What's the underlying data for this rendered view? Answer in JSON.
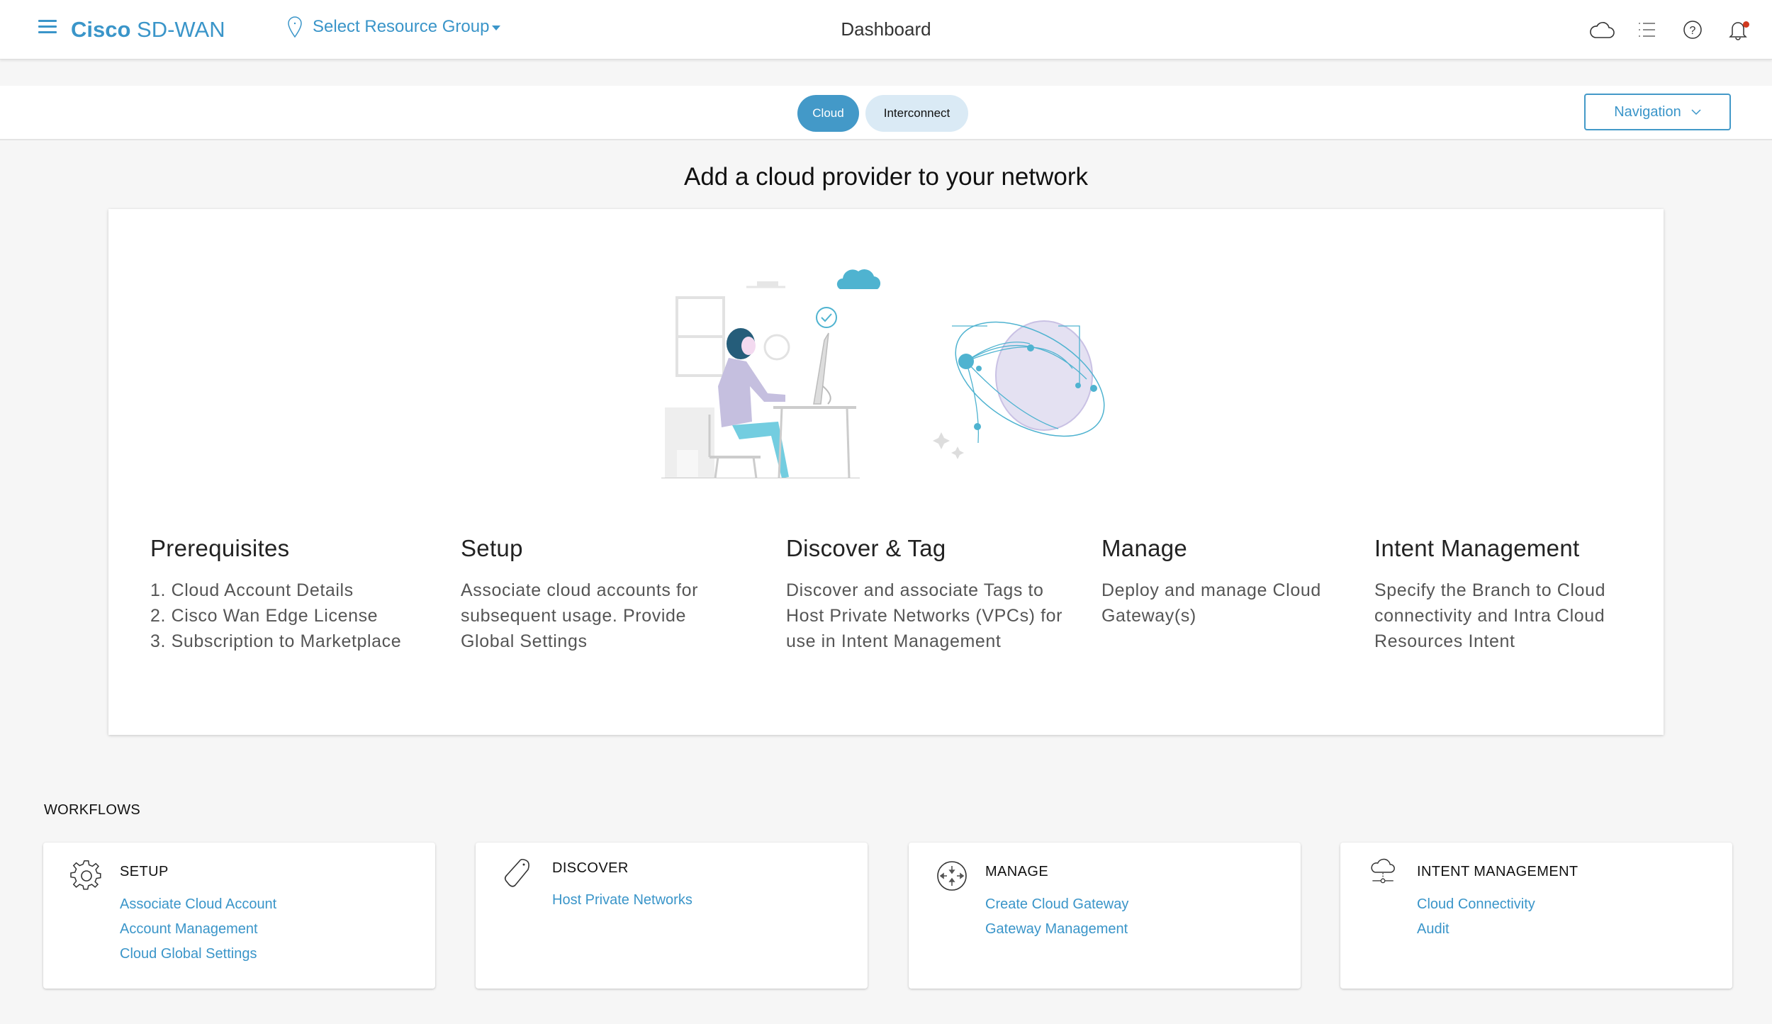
{
  "header": {
    "brand_bold": "Cisco",
    "brand_rest": "SD-WAN",
    "resource_group": "Select Resource Group",
    "title": "Dashboard",
    "icons": [
      "menu-icon",
      "location-pin-icon",
      "cloud-icon",
      "list-icon",
      "help-icon",
      "bell-icon"
    ]
  },
  "tabs": [
    {
      "label": "Cloud",
      "active": true
    },
    {
      "label": "Interconnect",
      "active": false
    }
  ],
  "navigation": {
    "label": "Navigation"
  },
  "main": {
    "heading": "Add a cloud provider to your network",
    "steps": [
      {
        "title": "Prerequisites",
        "items": [
          "1. Cloud Account Details",
          "2. Cisco Wan Edge License",
          "3. Subscription to Marketplace"
        ]
      },
      {
        "title": "Setup",
        "text": "Associate cloud accounts for subsequent usage. Provide Global Settings"
      },
      {
        "title": "Discover & Tag",
        "text": "Discover and associate Tags to Host Private Networks (VPCs) for use in Intent Management"
      },
      {
        "title": "Manage",
        "text": "Deploy and manage Cloud Gateway(s)"
      },
      {
        "title": "Intent Management",
        "text": "Specify the Branch to Cloud connectivity and Intra Cloud Resources Intent"
      }
    ]
  },
  "workflows": {
    "label": "WORKFLOWS",
    "cards": [
      {
        "title": "SETUP",
        "icon": "gear-icon",
        "links": [
          "Associate Cloud Account",
          "Account Management",
          "Cloud Global Settings"
        ]
      },
      {
        "title": "DISCOVER",
        "icon": "tag-icon",
        "links": [
          "Host Private Networks"
        ]
      },
      {
        "title": "MANAGE",
        "icon": "arrows-converge-icon",
        "links": [
          "Create Cloud Gateway",
          "Gateway Management"
        ]
      },
      {
        "title": "INTENT MANAGEMENT",
        "icon": "cloud-network-icon",
        "links": [
          "Cloud Connectivity",
          "Audit"
        ]
      }
    ]
  },
  "colors": {
    "accent": "#3a95c9",
    "active_tab": "#4399c8",
    "inactive_tab": "#daeaf5",
    "notification": "#d0391f"
  }
}
